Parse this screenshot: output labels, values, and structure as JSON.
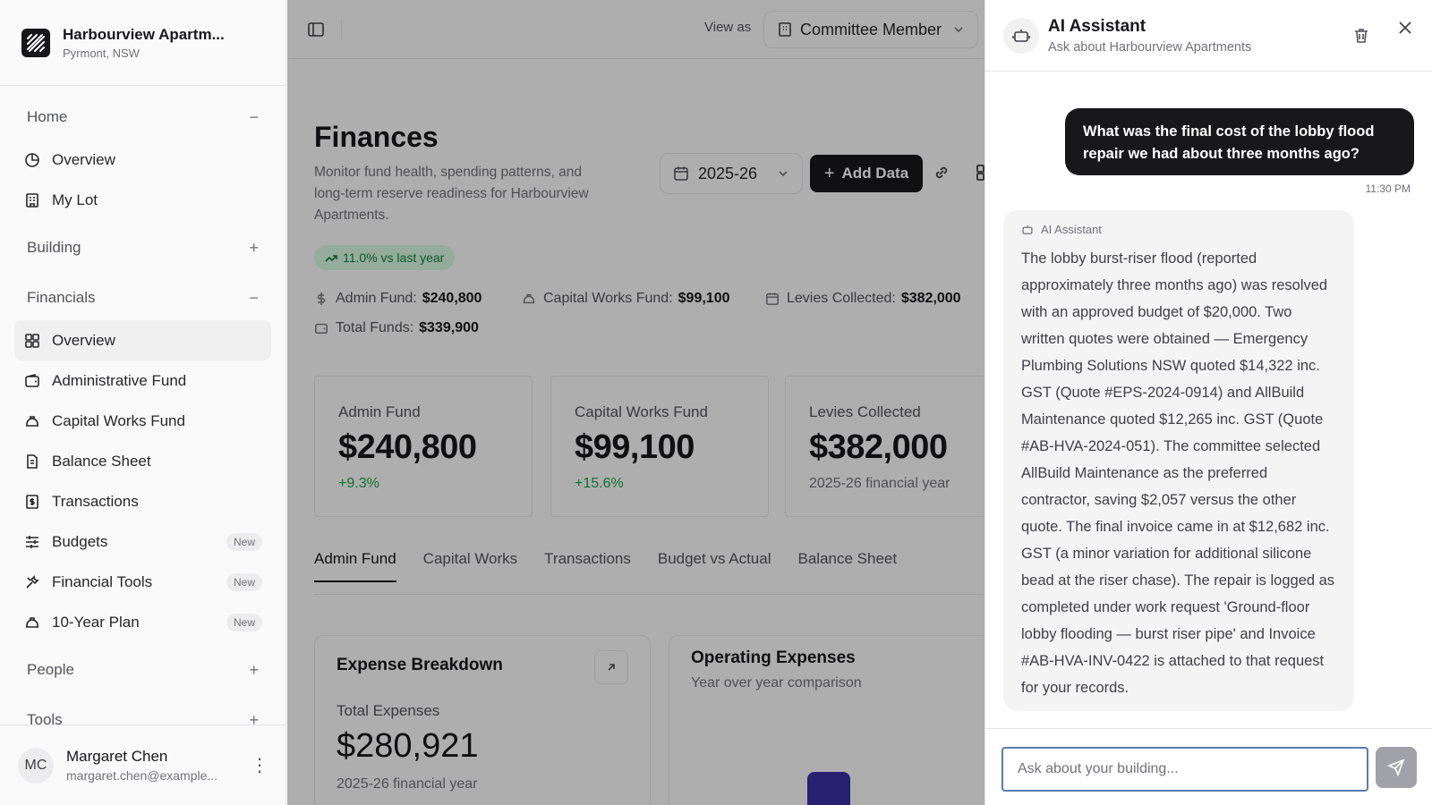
{
  "sidebar": {
    "building_name": "Harbourview Apartm...",
    "building_location": "Pyrmont, NSW",
    "groups": {
      "home": {
        "label": "Home",
        "sign": "−"
      },
      "building": {
        "label": "Building",
        "sign": "+"
      },
      "financials": {
        "label": "Financials",
        "sign": "−"
      },
      "people": {
        "label": "People",
        "sign": "+"
      },
      "tools": {
        "label": "Tools",
        "sign": "+"
      }
    },
    "home_items": [
      {
        "label": "Overview",
        "icon": "pie-chart-icon"
      },
      {
        "label": "My Lot",
        "icon": "building-icon"
      }
    ],
    "financial_items": [
      {
        "label": "Overview",
        "icon": "grid-icon",
        "active": true
      },
      {
        "label": "Administrative Fund",
        "icon": "wallet-icon"
      },
      {
        "label": "Capital Works Fund",
        "icon": "hardhat-icon"
      },
      {
        "label": "Balance Sheet",
        "icon": "document-icon"
      },
      {
        "label": "Transactions",
        "icon": "receipt-icon"
      },
      {
        "label": "Budgets",
        "icon": "sliders-icon",
        "badge": "New"
      },
      {
        "label": "Financial Tools",
        "icon": "tools-icon",
        "badge": "New"
      },
      {
        "label": "10-Year Plan",
        "icon": "hardhat-icon",
        "badge": "New"
      }
    ],
    "user": {
      "initials": "MC",
      "name": "Margaret Chen",
      "email": "margaret.chen@example..."
    }
  },
  "topbar": {
    "view_as_label": "View as",
    "role": "Committee Member"
  },
  "page": {
    "title": "Finances",
    "description": "Monitor fund health, spending patterns, and long-term reserve readiness for Harbourview Apartments.",
    "year": "2025-26",
    "add_button": "Add Data",
    "trend": "11.0% vs last year"
  },
  "stats": {
    "admin": {
      "label": "Admin Fund:",
      "value": "$240,800"
    },
    "capital": {
      "label": "Capital Works Fund:",
      "value": "$99,100"
    },
    "levies": {
      "label": "Levies Collected:",
      "value": "$382,000"
    },
    "total": {
      "label": "Total Funds:",
      "value": "$339,900"
    }
  },
  "cards": [
    {
      "label": "Admin Fund",
      "value": "$240,800",
      "delta": "+9.3%"
    },
    {
      "label": "Capital Works Fund",
      "value": "$99,100",
      "delta": "+15.6%"
    },
    {
      "label": "Levies Collected",
      "value": "$382,000",
      "sub": "2025-26 financial year"
    }
  ],
  "tabs": [
    "Admin Fund",
    "Capital Works",
    "Transactions",
    "Budget vs Actual",
    "Balance Sheet"
  ],
  "expense_panel": {
    "title": "Expense Breakdown",
    "label": "Total Expenses",
    "value": "$280,921",
    "note": "2025-26 financial year"
  },
  "opex_panel": {
    "title": "Operating Expenses",
    "subtitle": "Year over year comparison"
  },
  "assistant": {
    "title": "AI Assistant",
    "subtitle": "Ask about Harbourview Apartments",
    "user_message": "What was the final cost of the lobby flood repair we had about three months ago?",
    "user_time": "11:30 PM",
    "reply_author": "AI Assistant",
    "reply_text": "The lobby burst-riser flood (reported approximately three months ago) was resolved with an approved budget of $20,000. Two written quotes were obtained — Emergency Plumbing Solutions NSW quoted $14,322 inc. GST (Quote #EPS-2024-0914) and AllBuild Maintenance quoted $12,265 inc. GST (Quote #AB-HVA-2024-051). The committee selected AllBuild Maintenance as the preferred contractor, saving $2,057 versus the other quote. The final invoice came in at $12,682 inc. GST (a minor variation for additional silicone bead at the riser chase). The repair is logged as completed under work request 'Ground-floor lobby flooding — burst riser pipe' and Invoice #AB-HVA-INV-0422 is attached to that request for your records.",
    "input_placeholder": "Ask about your building..."
  },
  "colors": {
    "accent": "#18181b",
    "positive": "#16a34a",
    "trend_bg": "#d6f5df",
    "chart_bar": "#3730a3",
    "input_focus": "#5b7bb0"
  }
}
